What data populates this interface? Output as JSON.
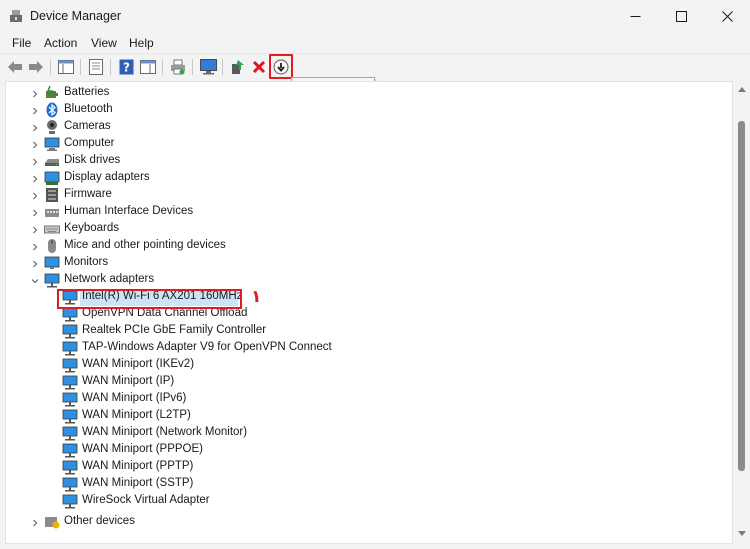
{
  "window": {
    "title": "Device Manager"
  },
  "menu": [
    "File",
    "Action",
    "View",
    "Help"
  ],
  "tooltip": "Disable device",
  "markers": {
    "one": "١",
    "two": "٢"
  },
  "accent_color": "#e31b23",
  "tree": {
    "categories": [
      {
        "label": "Batteries",
        "icon": "battery-icon"
      },
      {
        "label": "Bluetooth",
        "icon": "bluetooth-icon"
      },
      {
        "label": "Cameras",
        "icon": "camera-icon"
      },
      {
        "label": "Computer",
        "icon": "computer-icon"
      },
      {
        "label": "Disk drives",
        "icon": "disk-drive-icon"
      },
      {
        "label": "Display adapters",
        "icon": "display-adapter-icon"
      },
      {
        "label": "Firmware",
        "icon": "firmware-icon"
      },
      {
        "label": "Human Interface Devices",
        "icon": "hid-icon"
      },
      {
        "label": "Keyboards",
        "icon": "keyboard-icon"
      },
      {
        "label": "Mice and other pointing devices",
        "icon": "mouse-icon"
      },
      {
        "label": "Monitors",
        "icon": "monitor-icon"
      },
      {
        "label": "Network adapters",
        "icon": "network-adapter-icon"
      }
    ],
    "network_adapters": [
      "Intel(R) Wi-Fi 6 AX201 160MHz",
      "OpenVPN Data Channel Offload",
      "Realtek PCIe GbE Family Controller",
      "TAP-Windows Adapter V9 for OpenVPN Connect",
      "WAN Miniport (IKEv2)",
      "WAN Miniport (IP)",
      "WAN Miniport (IPv6)",
      "WAN Miniport (L2TP)",
      "WAN Miniport (Network Monitor)",
      "WAN Miniport (PPPOE)",
      "WAN Miniport (PPTP)",
      "WAN Miniport (SSTP)",
      "WireSock Virtual Adapter"
    ],
    "other_devices": "Other devices"
  }
}
